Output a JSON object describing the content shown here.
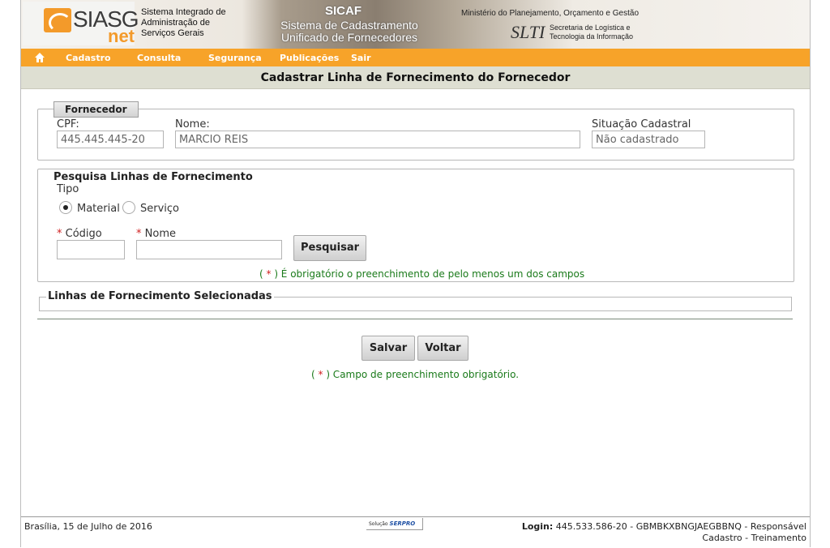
{
  "header": {
    "logo_main": "SIASG",
    "logo_sub": "net",
    "system_name_lines": [
      "Sistema Integrado de",
      "Administração de",
      "Serviços Gerais"
    ],
    "sicaf_title": "SICAF",
    "sicaf_sub_lines": [
      "Sistema de Cadastramento",
      "Unificado de Fornecedores"
    ],
    "ministry": "Ministério do Planejamento, Orçamento e Gestão",
    "slti_mark": "SLTI",
    "slti_lines": [
      "Secretaria de Logística e",
      "Tecnologia da Informação"
    ]
  },
  "menu": {
    "home_icon": "home-icon",
    "items": [
      "Cadastro",
      "Consulta",
      "Segurança",
      "Publicações",
      "Sair"
    ]
  },
  "page": {
    "title": "Cadastrar Linha de Fornecimento do Fornecedor"
  },
  "fornecedor": {
    "legend": "Fornecedor",
    "cpf_label": "CPF:",
    "cpf_value": "445.445.445-20",
    "nome_label": "Nome:",
    "nome_value": "MARCIO REIS",
    "situacao_label": "Situação Cadastral",
    "situacao_value": "Não cadastrado"
  },
  "pesquisa": {
    "legend": "Pesquisa Linhas de Fornecimento",
    "tipo_label": "Tipo",
    "radio_material": "Material",
    "radio_servico": "Serviço",
    "selected": "Material",
    "codigo_label": "Código",
    "nome_label": "Nome",
    "required_mark": "*",
    "codigo_value": "",
    "nome_value": "",
    "search_button": "Pesquisar",
    "note_prefix": "( ",
    "note_suffix": " ) É obrigatório o preenchimento de pelo menos um dos campos"
  },
  "selecionadas": {
    "legend": "Linhas de Fornecimento Selecionadas"
  },
  "actions": {
    "save": "Salvar",
    "back": "Voltar",
    "note_prefix": "( ",
    "note_suffix": " ) Campo de preenchimento obrigatório."
  },
  "footer": {
    "date": "Brasília, 15 de Julho de 2016",
    "serpro_prefix": "Solução",
    "serpro_name": "SERPRO",
    "login_label": "Login:",
    "login_value": "445.533.586-20 - GBMBKXBNGJAEGBBNQ - Responsável",
    "login_line2": "Cadastro - Treinamento"
  },
  "colors": {
    "menu_bg": "#f7a329",
    "titlebar_bg": "#dedfd2",
    "required": "#d02020",
    "note_green": "#1a7a1a"
  }
}
